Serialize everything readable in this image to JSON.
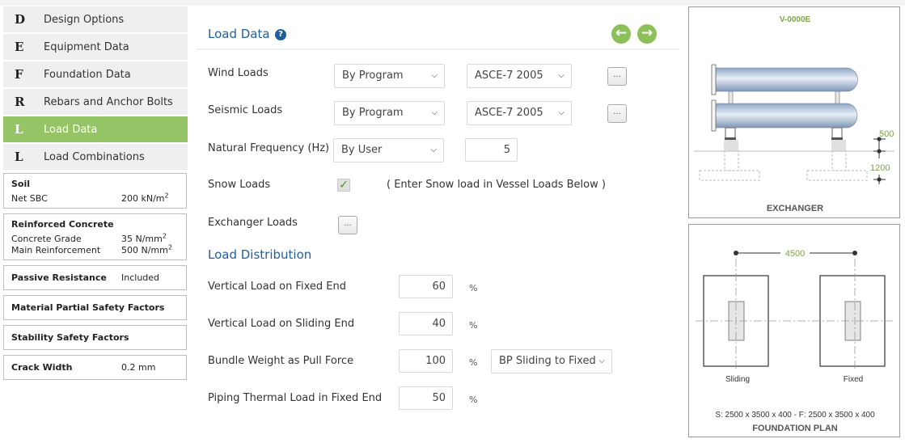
{
  "sidebar": {
    "nav": [
      {
        "letter": "D",
        "label": "Design Options",
        "active": false
      },
      {
        "letter": "E",
        "label": "Equipment Data",
        "active": false
      },
      {
        "letter": "F",
        "label": "Foundation Data",
        "active": false
      },
      {
        "letter": "R",
        "label": "Rebars and Anchor Bolts",
        "active": false
      },
      {
        "letter": "L",
        "label": "Load Data",
        "active": true
      },
      {
        "letter": "L",
        "label": "Load Combinations",
        "active": false
      }
    ],
    "soil": {
      "title": "Soil",
      "net_sbc_label": "Net SBC",
      "net_sbc_value": "200 kN/m",
      "net_sbc_sup": "2"
    },
    "concrete": {
      "title": "Reinforced Concrete",
      "grade_label": "Concrete Grade",
      "grade_value": "35 N/mm",
      "grade_sup": "2",
      "reinf_label": "Main Reinforcement",
      "reinf_value": "500 N/mm",
      "reinf_sup": "2"
    },
    "passive": {
      "title": "Passive Resistance",
      "value": "Included"
    },
    "material_factors": {
      "title": "Material Partial Safety Factors"
    },
    "stability_factors": {
      "title": "Stability Safety Factors"
    },
    "crack": {
      "title": "Crack Width",
      "value": "0.2 mm"
    }
  },
  "header": {
    "title": "Load Data",
    "help_icon": "?",
    "prev_icon": "←",
    "next_icon": "→"
  },
  "form": {
    "wind": {
      "label": "Wind Loads",
      "method": "By Program",
      "code": "ASCE-7 2005",
      "more": "..."
    },
    "seismic": {
      "label": "Seismic Loads",
      "method": "By Program",
      "code": "ASCE-7 2005",
      "more": "..."
    },
    "frequency": {
      "label": "Natural Frequency (Hz)",
      "method": "By User",
      "value": "5"
    },
    "snow": {
      "label": "Snow Loads",
      "checked": true,
      "check_glyph": "✓",
      "note": "( Enter Snow load in Vessel Loads Below )"
    },
    "exchanger": {
      "label": "Exchanger Loads",
      "more": "..."
    },
    "chevron": "⌵"
  },
  "distribution": {
    "title": "Load Distribution",
    "fixed": {
      "label": "Vertical Load on Fixed End",
      "value": "60",
      "unit": "%"
    },
    "sliding": {
      "label": "Vertical Load on Sliding End",
      "value": "40",
      "unit": "%"
    },
    "bundle": {
      "label": "Bundle Weight as Pull Force",
      "value": "100",
      "unit": "%",
      "direction": "BP Sliding to Fixed"
    },
    "piping": {
      "label": "Piping Thermal Load in Fixed End",
      "value": "50",
      "unit": "%"
    }
  },
  "exchanger_panel": {
    "tag": "V-0000E",
    "dim_top": "500",
    "dim_bottom": "1200",
    "caption": "EXCHANGER"
  },
  "plan_panel": {
    "spacing": "4500",
    "left_label": "Sliding",
    "right_label": "Fixed",
    "sizes": "S: 2500 x 3500 x 400 - F: 2500 x 3500 x 400",
    "caption": "FOUNDATION PLAN"
  },
  "colors": {
    "accent_green": "#95c466",
    "heading_blue": "#1f5f9e",
    "dim_green": "#7aa44a"
  }
}
